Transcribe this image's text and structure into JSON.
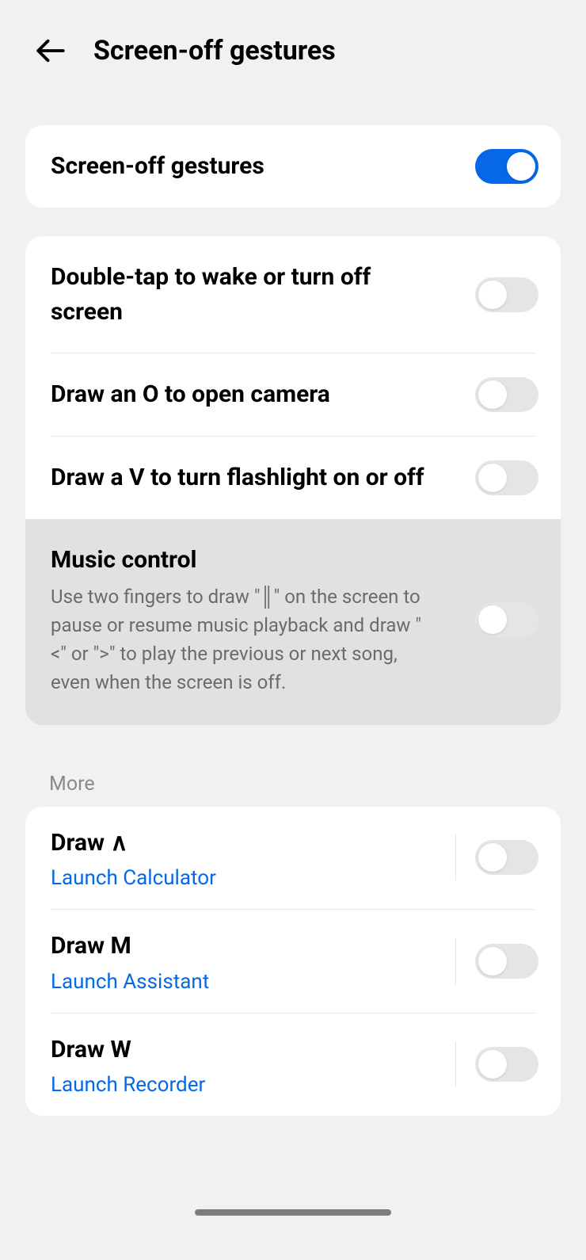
{
  "header": {
    "title": "Screen-off gestures"
  },
  "main_toggle": {
    "label": "Screen-off gestures",
    "on": true
  },
  "gestures": [
    {
      "label": "Double-tap to wake or turn off screen",
      "on": false
    },
    {
      "label": "Draw an O to open camera",
      "on": false
    },
    {
      "label": "Draw a V to turn flashlight on or off",
      "on": false
    }
  ],
  "music": {
    "title": "Music control",
    "desc": "Use two fingers to draw \"║\" on the screen to pause or resume music playback and draw \"<\" or \">\" to play the previous or next song, even when the screen is off.",
    "on": false
  },
  "more_label": "More",
  "more": [
    {
      "title": "Draw ∧",
      "action": "Launch  Calculator",
      "on": false
    },
    {
      "title": "Draw M",
      "action": "Launch  Assistant",
      "on": false
    },
    {
      "title": "Draw W",
      "action": "Launch  Recorder",
      "on": false
    }
  ]
}
